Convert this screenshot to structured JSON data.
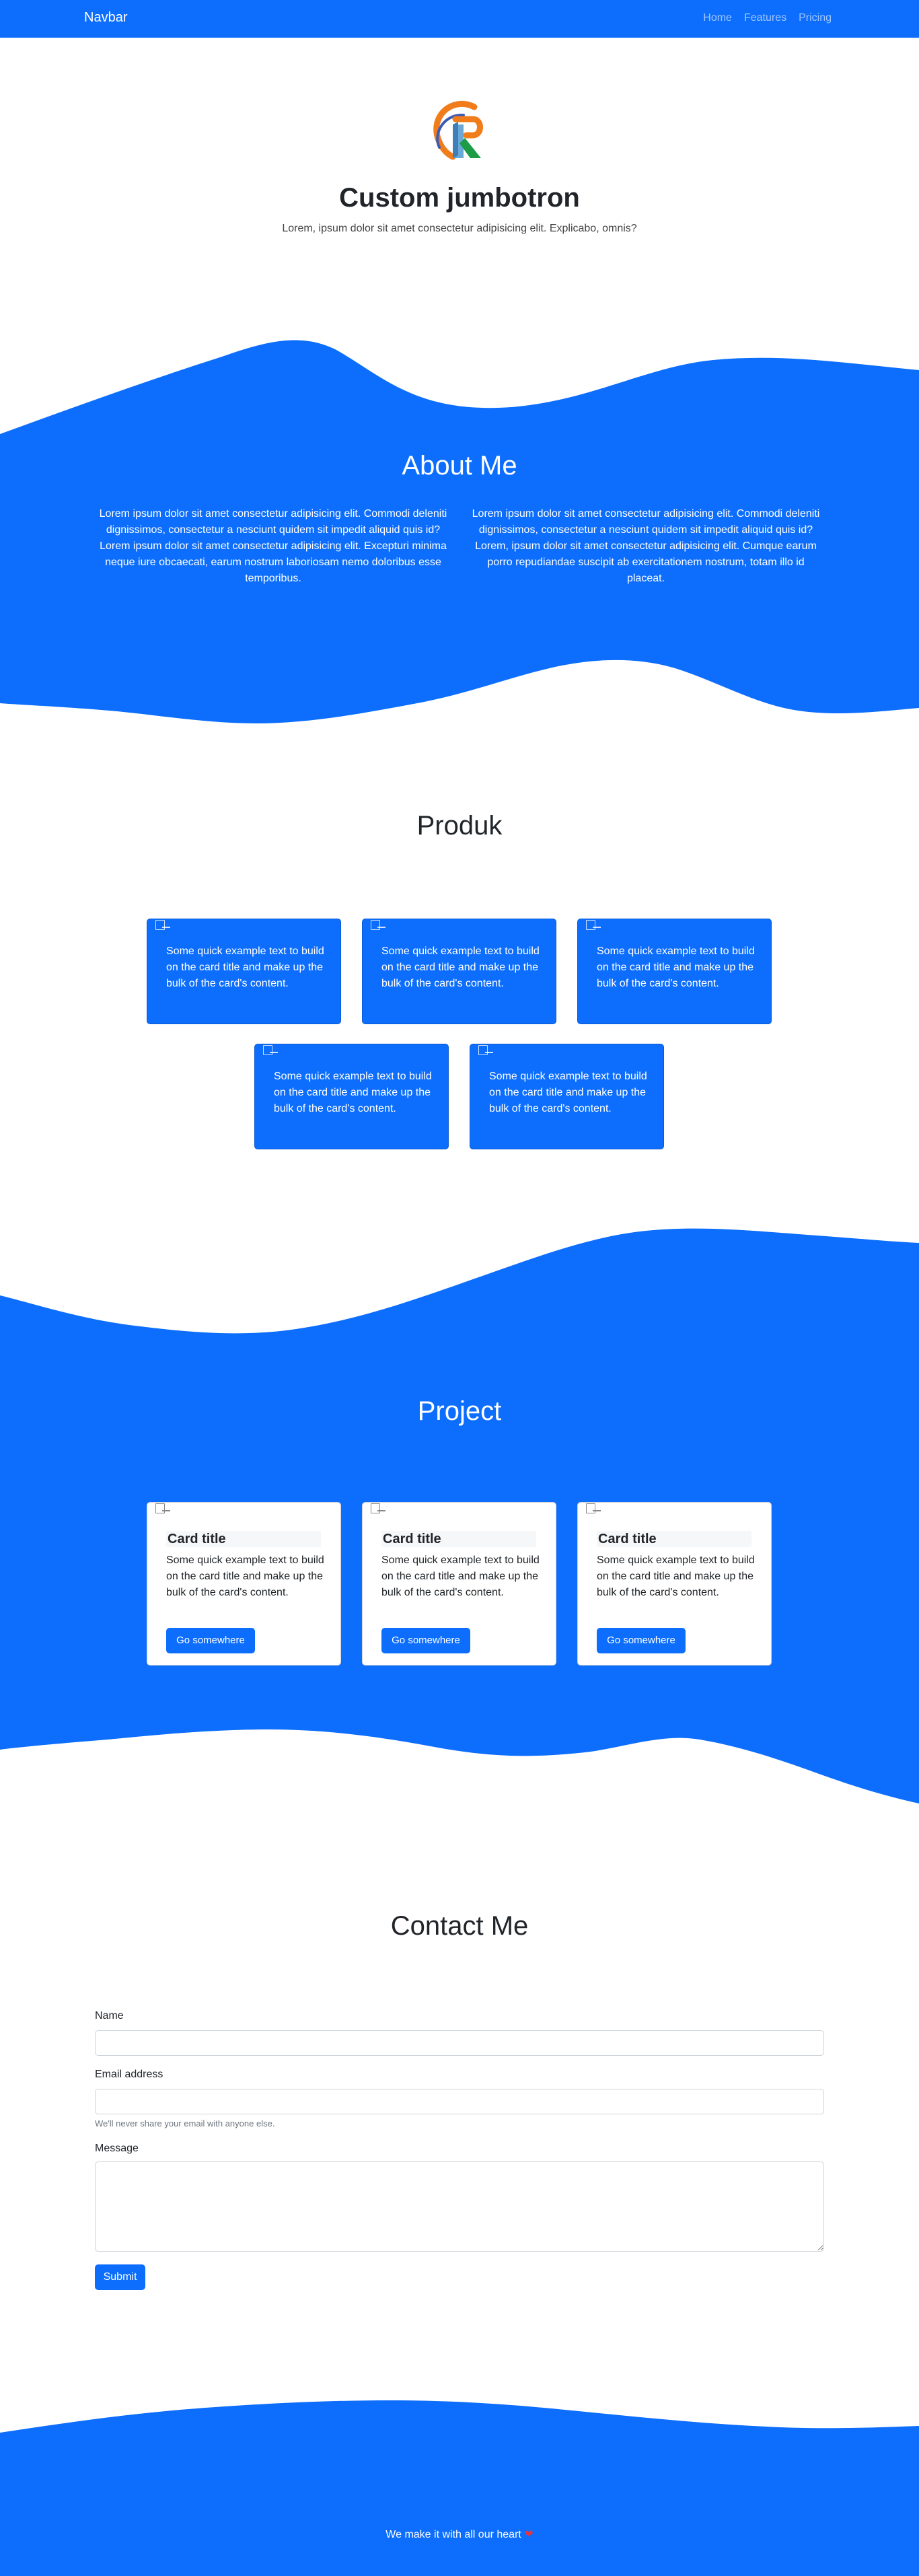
{
  "navbar": {
    "brand": "Navbar",
    "links": [
      "Home",
      "Features",
      "Pricing"
    ]
  },
  "jumbotron": {
    "title": "Custom jumbotron",
    "lead": "Lorem, ipsum dolor sit amet consectetur adipisicing elit. Explicabo, omnis?"
  },
  "about": {
    "title": "About Me",
    "left": "Lorem ipsum dolor sit amet consectetur adipisicing elit. Commodi deleniti dignissimos, consectetur a nesciunt quidem sit impedit aliquid quis id? Lorem ipsum dolor sit amet consectetur adipisicing elit. Excepturi minima neque iure obcaecati, earum nostrum laboriosam nemo doloribus esse temporibus.",
    "right": "Lorem ipsum dolor sit amet consectetur adipisicing elit. Commodi deleniti dignissimos, consectetur a nesciunt quidem sit impedit aliquid quis id? Lorem, ipsum dolor sit amet consectetur adipisicing elit. Cumque earum porro repudiandae suscipit ab exercitationem nostrum, totam illo id placeat."
  },
  "produk": {
    "title": "Produk",
    "card_text": "Some quick example text to build on the card title and make up the bulk of the card's content."
  },
  "project": {
    "title": "Project",
    "card_title": "Card title",
    "card_text": "Some quick example text to build on the card title and make up the bulk of the card's content.",
    "button": "Go somewhere"
  },
  "contact": {
    "title": "Contact Me",
    "name_label": "Name",
    "email_label": "Email address",
    "email_help": "We'll never share your email with anyone else.",
    "message_label": "Message",
    "submit": "Submit"
  },
  "footer": {
    "text": "We make it with all our heart",
    "heart": "❤"
  },
  "colors": {
    "primary": "#0d6efd",
    "heart": "#dc3545"
  }
}
